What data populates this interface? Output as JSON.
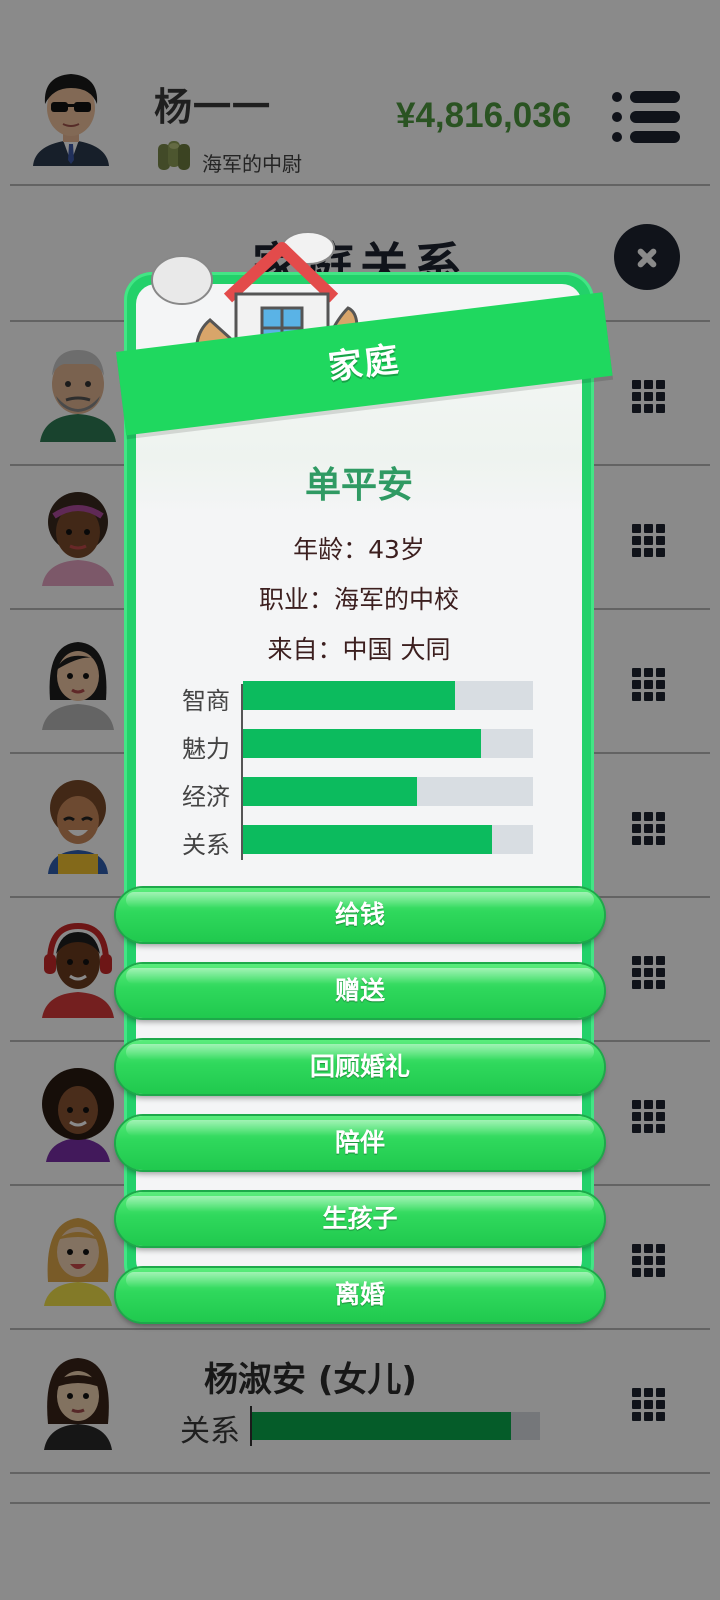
{
  "header": {
    "player_name": "杨一一",
    "rank": "海军的中尉",
    "money": "¥4,816,036"
  },
  "section_title": "家庭关系",
  "family_list": [
    {
      "avatar": "grandfather-avatar"
    },
    {
      "avatar": "woman-headband-avatar"
    },
    {
      "avatar": "woman-black-hair-avatar"
    },
    {
      "avatar": "child-curly-avatar"
    },
    {
      "avatar": "man-headphones-avatar"
    },
    {
      "avatar": "woman-curly-avatar"
    },
    {
      "avatar": "girl-blonde-avatar"
    },
    {
      "avatar": "daughter-avatar",
      "name": "杨淑安 (女儿)",
      "relation_label": "关系",
      "relation_value": 0.9
    }
  ],
  "modal": {
    "ribbon_title": "家庭",
    "person_name": "单平安",
    "age": "年龄：43岁",
    "job": "职业：海军的中校",
    "from": "来自：中国 大同",
    "stats": [
      {
        "label": "智商",
        "value": 0.73
      },
      {
        "label": "魅力",
        "value": 0.82
      },
      {
        "label": "经济",
        "value": 0.6
      },
      {
        "label": "关系",
        "value": 0.86
      }
    ],
    "actions": [
      {
        "label": "给钱"
      },
      {
        "label": "赠送"
      },
      {
        "label": "回顾婚礼"
      },
      {
        "label": "陪伴"
      },
      {
        "label": "生孩子"
      },
      {
        "label": "离婚"
      }
    ]
  },
  "colors": {
    "accent_green": "#1fd85f",
    "money_green": "#4f9a3f",
    "stat_fill": "#0cbb5e",
    "dark": "#1e2430"
  }
}
